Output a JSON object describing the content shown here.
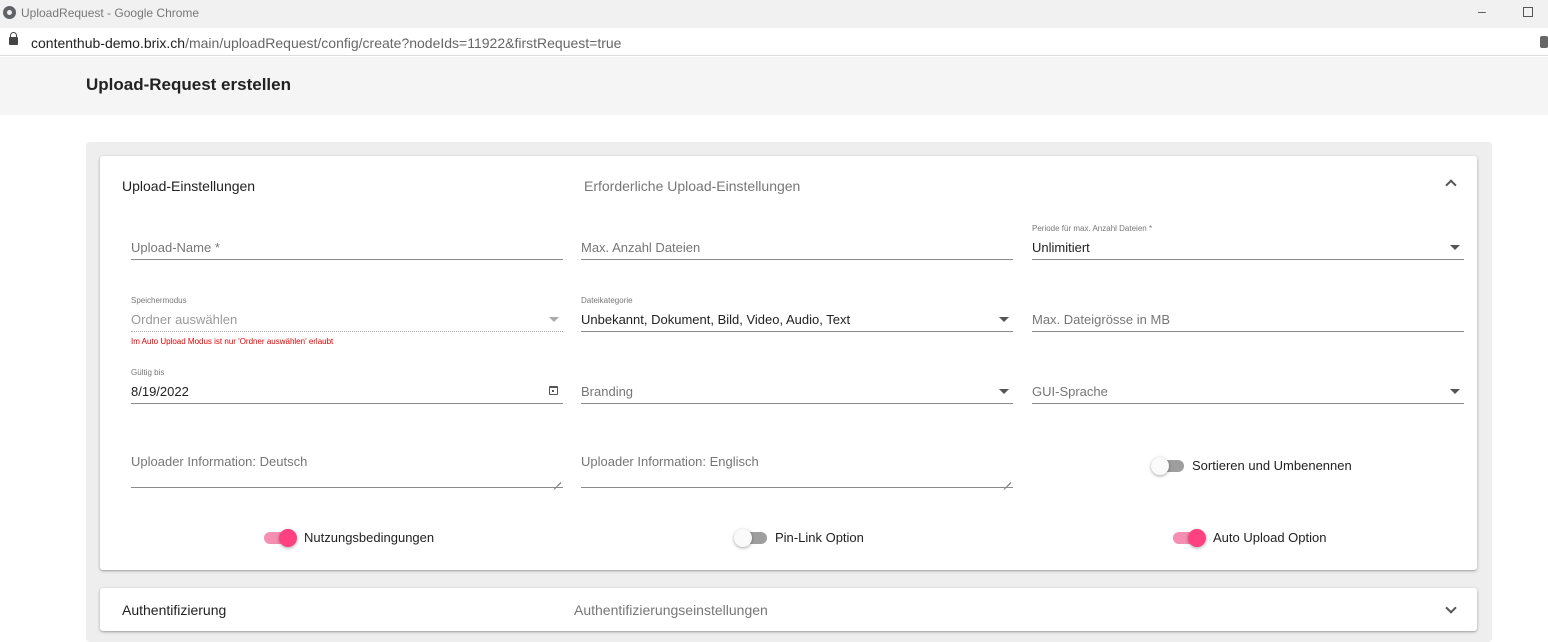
{
  "window": {
    "title": "UploadRequest - Google Chrome",
    "url_host": "contenthub-demo.brix.ch",
    "url_path": "/main/uploadRequest/config/create?nodeIds=11922&firstRequest=true"
  },
  "page": {
    "title": "Upload-Request erstellen"
  },
  "upload_panel": {
    "title": "Upload-Einstellungen",
    "description": "Erforderliche Upload-Einstellungen",
    "expanded": true,
    "fields": {
      "upload_name": {
        "placeholder": "Upload-Name *"
      },
      "max_files": {
        "placeholder": "Max. Anzahl Dateien"
      },
      "period": {
        "label": "Periode für max. Anzahl Dateien *",
        "value": "Unlimitiert"
      },
      "storage_mode": {
        "label": "Speichermodus",
        "value": "Ordner auswählen",
        "error": "Im Auto Upload Modus ist nur 'Ordner auswählen' erlaubt"
      },
      "file_category": {
        "label": "Dateikategorie",
        "value": "Unbekannt, Dokument, Bild, Video, Audio, Text"
      },
      "max_file_size": {
        "placeholder": "Max. Dateigrösse in MB"
      },
      "valid_until": {
        "label": "Gültig bis",
        "value": "8/19/2022"
      },
      "branding": {
        "placeholder": "Branding"
      },
      "gui_language": {
        "placeholder": "GUI-Sprache"
      },
      "uploader_info_de": {
        "placeholder": "Uploader Information: Deutsch"
      },
      "uploader_info_en": {
        "placeholder": "Uploader Information: Englisch"
      }
    },
    "toggles": {
      "sort_rename": {
        "label": "Sortieren und Umbenennen",
        "on": false
      },
      "terms": {
        "label": "Nutzungsbedingungen",
        "on": true
      },
      "pin_link": {
        "label": "Pin-Link Option",
        "on": false
      },
      "auto_upload": {
        "label": "Auto Upload Option",
        "on": true
      }
    }
  },
  "auth_panel": {
    "title": "Authentifizierung",
    "description": "Authentifizierungseinstellungen",
    "expanded": false
  },
  "colors": {
    "accent": "#ff4081",
    "accent_track": "#f48fb1",
    "error": "#e00000"
  }
}
